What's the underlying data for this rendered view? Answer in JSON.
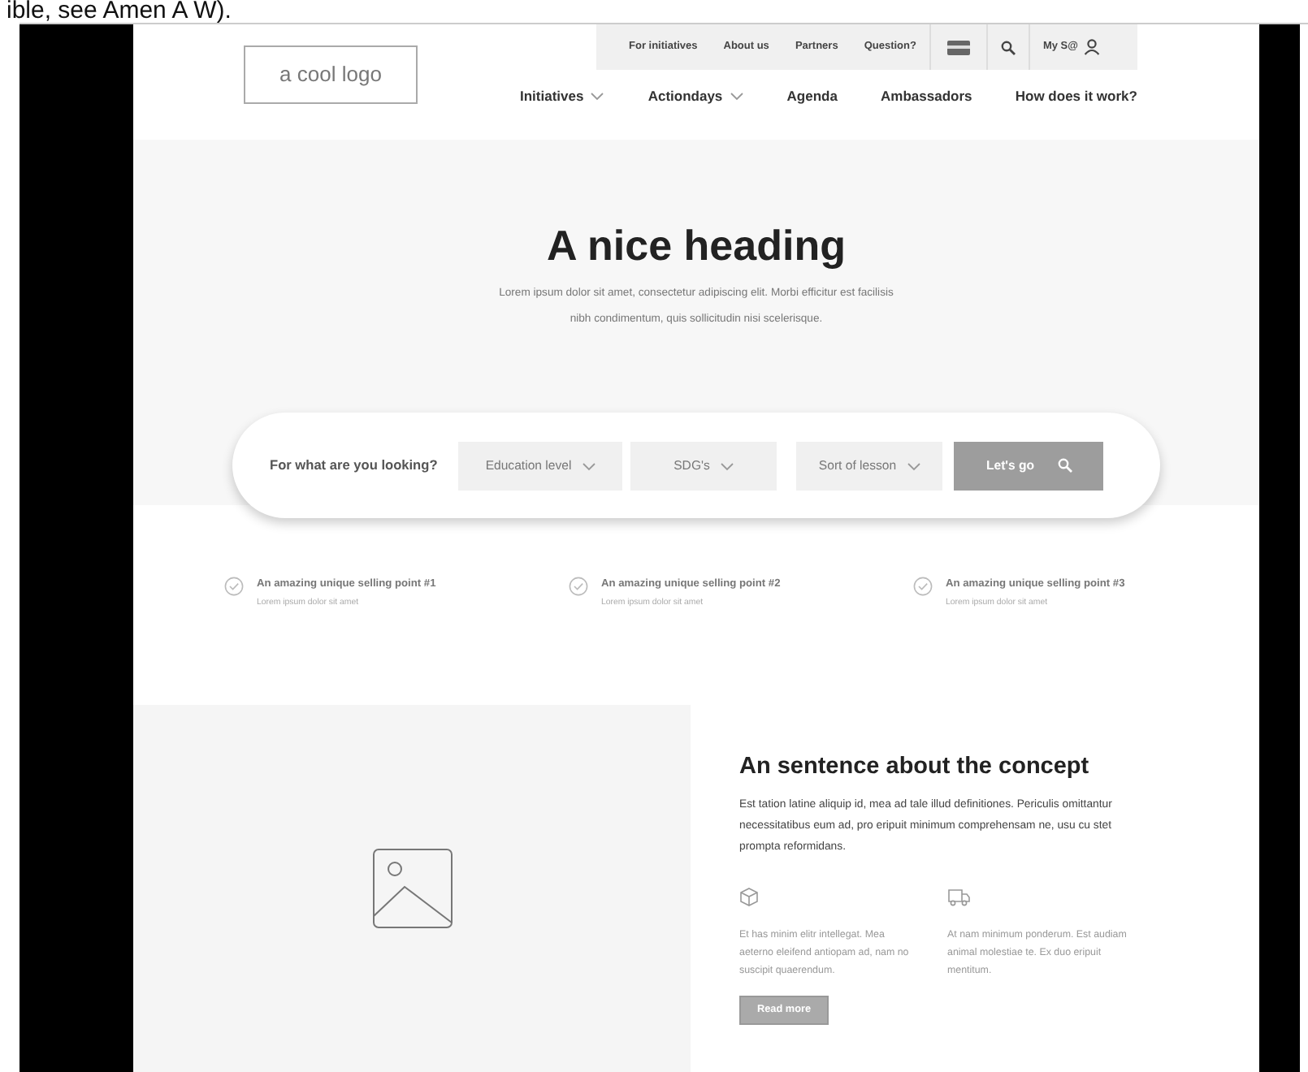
{
  "caption": "ible, see Amen A W).",
  "logo": "a cool logo",
  "utility_nav": [
    "For initiatives",
    "About us",
    "Partners",
    "Question?"
  ],
  "account_label": "My S@",
  "main_nav": [
    {
      "label": "Initiatives",
      "dropdown": true
    },
    {
      "label": "Actiondays",
      "dropdown": true
    },
    {
      "label": "Agenda",
      "dropdown": false
    },
    {
      "label": "Ambassadors",
      "dropdown": false
    },
    {
      "label": "How does it work?",
      "dropdown": false
    }
  ],
  "hero": {
    "heading": "A nice heading",
    "text": "Lorem ipsum dolor sit amet, consectetur adipiscing elit. Morbi efficitur est facilisis nibh condimentum, quis sollicitudin nisi scelerisque."
  },
  "search": {
    "label": "For what are you looking?",
    "filters": [
      "Education level",
      "SDG's",
      "Sort of lesson"
    ],
    "button": "Let's go"
  },
  "usps": [
    {
      "title": "An amazing unique selling point #1",
      "text": "Lorem ipsum dolor sit amet"
    },
    {
      "title": "An amazing unique selling point #2",
      "text": "Lorem ipsum dolor sit amet"
    },
    {
      "title": "An amazing unique selling point #3",
      "text": "Lorem ipsum dolor sit amet"
    }
  ],
  "concept": {
    "heading": "An sentence about the concept",
    "text": "Est tation latine aliquip id, mea ad tale illud definitiones. Periculis omittantur necessitatibus eum ad, pro eripuit minimum comprehensam ne, usu cu stet prompta reformidans.",
    "features": [
      {
        "kind": "box",
        "text": "Et has minim elitr intellegat. Mea aeterno eleifend antiopam ad, nam no suscipit quaerendum."
      },
      {
        "kind": "truck",
        "text": "At nam minimum ponderum. Est audiam animal molestiae te. Ex duo eripuit mentitum."
      }
    ],
    "button": "Read more"
  }
}
